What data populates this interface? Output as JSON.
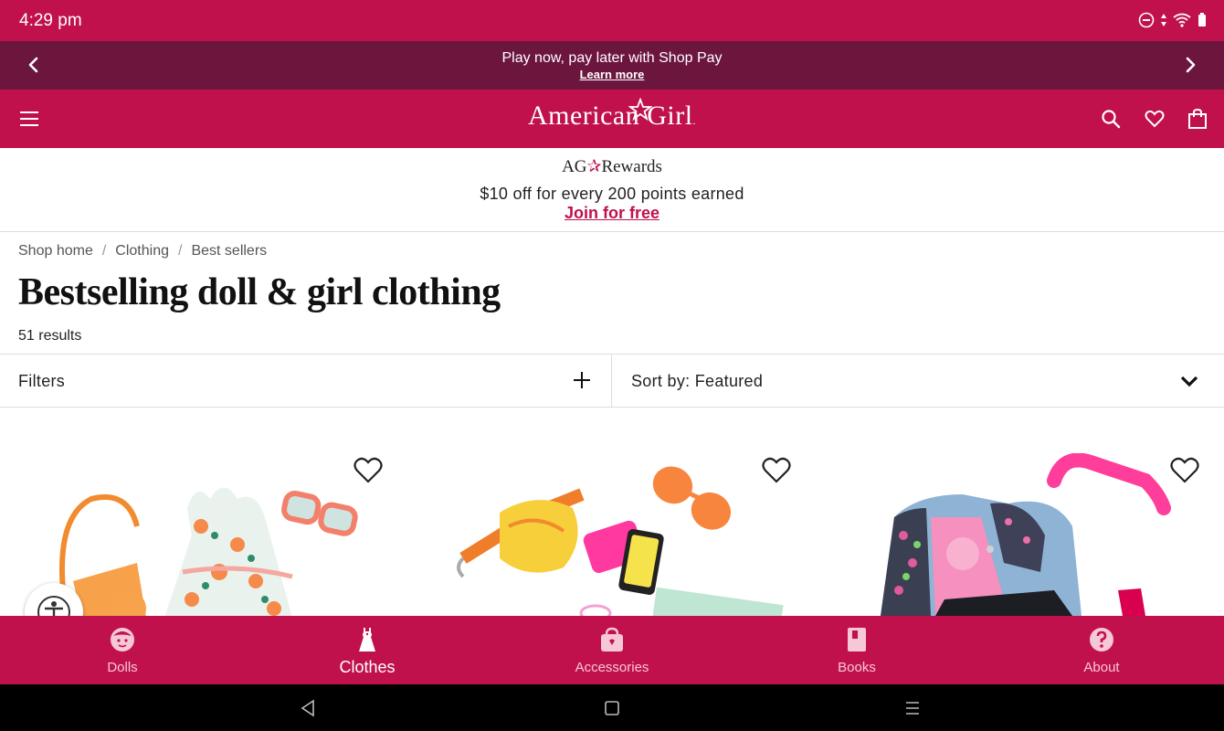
{
  "status_bar": {
    "time": "4:29 pm"
  },
  "promo": {
    "text": "Play now, pay later with Shop Pay",
    "link": "Learn more"
  },
  "header": {
    "logo": "American Girl",
    "logo_mark": "."
  },
  "rewards": {
    "logo_left": "AG",
    "logo_right": "Rewards",
    "text": "$10 off for every 200 points earned",
    "link": "Join for free"
  },
  "breadcrumb": {
    "items": [
      "Shop home",
      "Clothing",
      "Best sellers"
    ],
    "separator": "/"
  },
  "page": {
    "title": "Bestselling doll & girl clothing",
    "results": "51 results"
  },
  "toolbar": {
    "filters_label": "Filters",
    "sort_label": "Sort by: Featured"
  },
  "bottom_nav": {
    "items": [
      {
        "label": "Dolls",
        "icon": "doll-face-icon"
      },
      {
        "label": "Clothes",
        "icon": "dress-icon"
      },
      {
        "label": "Accessories",
        "icon": "bag-icon"
      },
      {
        "label": "Books",
        "icon": "book-icon"
      },
      {
        "label": "About",
        "icon": "question-icon"
      }
    ],
    "active": "Clothes"
  },
  "colors": {
    "brand": "#c0114d",
    "promo_bg": "#6c163e"
  }
}
